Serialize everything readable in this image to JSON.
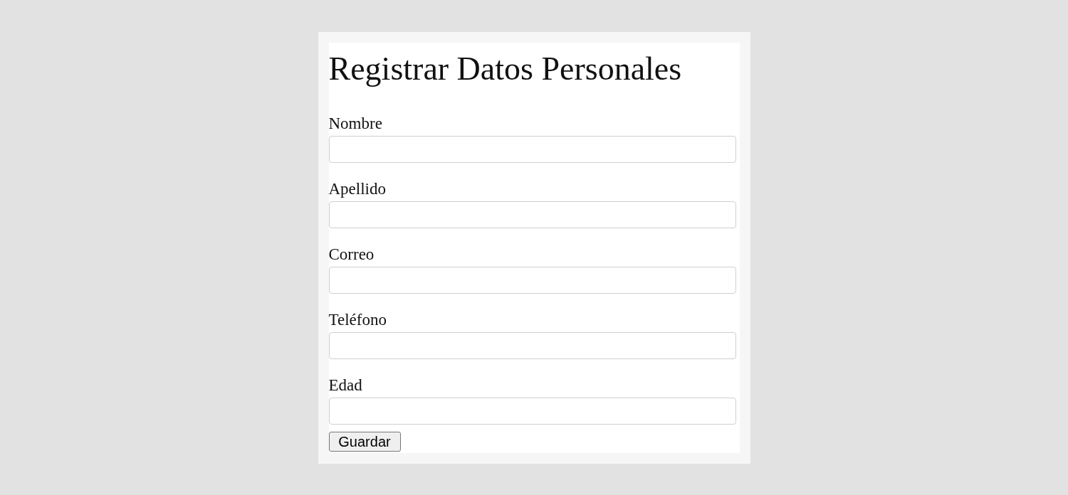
{
  "form": {
    "title": "Registrar Datos Personales",
    "fields": [
      {
        "label": "Nombre"
      },
      {
        "label": "Apellido"
      },
      {
        "label": "Correo"
      },
      {
        "label": "Teléfono"
      },
      {
        "label": "Edad"
      }
    ],
    "buttons": [
      {
        "label": "Guardar"
      }
    ]
  }
}
